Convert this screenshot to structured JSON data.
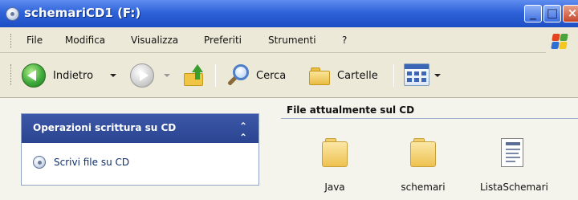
{
  "window": {
    "title": "schemariCD1 (F:)",
    "controls": {
      "minimize": "_",
      "maximize": "□",
      "close": "×"
    }
  },
  "menu": {
    "items": [
      "File",
      "Modifica",
      "Visualizza",
      "Preferiti",
      "Strumenti",
      "?"
    ]
  },
  "toolbar": {
    "back_label": "Indietro",
    "search_label": "Cerca",
    "folders_label": "Cartelle"
  },
  "task_pane": {
    "title": "Operazioni scrittura su CD",
    "link_label": "Scrivi file su CD"
  },
  "files_section": {
    "heading": "File attualmente sul CD",
    "items": [
      {
        "name": "Java",
        "type": "folder"
      },
      {
        "name": "schemari",
        "type": "folder"
      },
      {
        "name": "ListaSchemari",
        "type": "document"
      }
    ]
  }
}
